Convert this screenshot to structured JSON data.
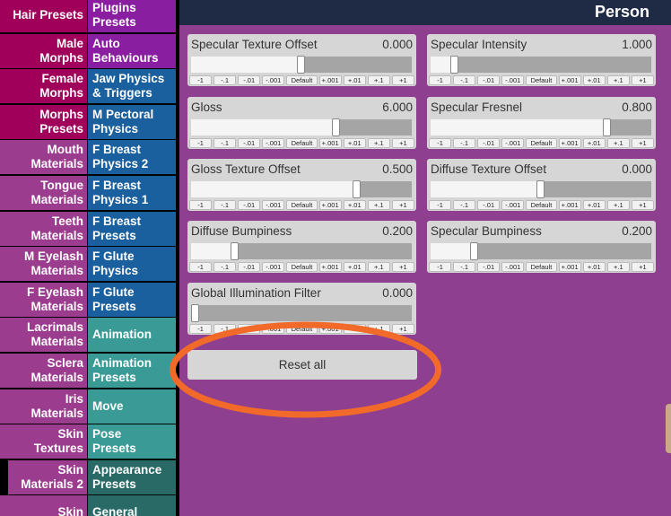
{
  "title": "Person",
  "colors": {
    "panel_bg": "#8e3f8f",
    "title_bar": "#1f2a44",
    "highlight_circle": "#f26a2a"
  },
  "left_tabs": [
    {
      "label": "Hair Presets",
      "color": "#a0005a"
    },
    {
      "label": "Male\nMorphs",
      "color": "#a0005a"
    },
    {
      "label": "Female\nMorphs",
      "color": "#a0005a"
    },
    {
      "label": "Morphs\nPresets",
      "color": "#a0005a"
    },
    {
      "label": "Mouth\nMaterials",
      "color": "#9c3c8e"
    },
    {
      "label": "Tongue\nMaterials",
      "color": "#9c3c8e"
    },
    {
      "label": "Teeth\nMaterials",
      "color": "#9c3c8e"
    },
    {
      "label": "M Eyelash\nMaterials",
      "color": "#9c3c8e"
    },
    {
      "label": "F Eyelash\nMaterials",
      "color": "#9c3c8e"
    },
    {
      "label": "Lacrimals\nMaterials",
      "color": "#9c3c8e"
    },
    {
      "label": "Sclera\nMaterials",
      "color": "#9c3c8e"
    },
    {
      "label": "Iris\nMaterials",
      "color": "#9c3c8e"
    },
    {
      "label": "Skin\nTextures",
      "color": "#9c3c8e"
    },
    {
      "label": "Skin\nMaterials 2",
      "color": "#9c3c8e",
      "active": true
    },
    {
      "label": "Skin",
      "color": "#9c3c8e"
    }
  ],
  "right_tabs": [
    {
      "label": "Plugins\nPresets",
      "color": "#8a1ea0"
    },
    {
      "label": "Auto\nBehaviours",
      "color": "#8a1ea0"
    },
    {
      "label": "Jaw Physics\n& Triggers",
      "color": "#1a5f9e"
    },
    {
      "label": "M Pectoral\nPhysics",
      "color": "#1a5f9e"
    },
    {
      "label": "F Breast\nPhysics 2",
      "color": "#1a5f9e"
    },
    {
      "label": "F Breast\nPhysics 1",
      "color": "#1a5f9e"
    },
    {
      "label": "F Breast\nPresets",
      "color": "#1a5f9e"
    },
    {
      "label": "F Glute\nPhysics",
      "color": "#1a5f9e"
    },
    {
      "label": "F Glute\nPresets",
      "color": "#1a5f9e"
    },
    {
      "label": "Animation",
      "color": "#3a9a96"
    },
    {
      "label": "Animation\nPresets",
      "color": "#3a9a96"
    },
    {
      "label": "Move",
      "color": "#3a9a96"
    },
    {
      "label": "Pose\nPresets",
      "color": "#3a9a96"
    },
    {
      "label": "Appearance\nPresets",
      "color": "#2a6a66"
    },
    {
      "label": "General",
      "color": "#2a6a66"
    }
  ],
  "step_buttons": [
    "-1",
    "-.1",
    "-.01",
    "-.001",
    "Default",
    "+.001",
    "+.01",
    "+.1",
    "+1"
  ],
  "sliders": [
    {
      "label": "Specular Texture Offset",
      "value": "0.000",
      "level": 0.5
    },
    {
      "label": "Specular Intensity",
      "value": "1.000",
      "level": 0.11
    },
    {
      "label": "Gloss",
      "value": "6.000",
      "level": 0.66
    },
    {
      "label": "Specular Fresnel",
      "value": "0.800",
      "level": 0.8
    },
    {
      "label": "Gloss Texture Offset",
      "value": "0.500",
      "level": 0.75
    },
    {
      "label": "Diffuse Texture Offset",
      "value": "0.000",
      "level": 0.5
    },
    {
      "label": "Diffuse Bumpiness",
      "value": "0.200",
      "level": 0.2
    },
    {
      "label": "Specular Bumpiness",
      "value": "0.200",
      "level": 0.2
    },
    {
      "label": "Global Illumination Filter",
      "value": "0.000",
      "level": 0.0
    }
  ],
  "reset_label": "Reset all"
}
